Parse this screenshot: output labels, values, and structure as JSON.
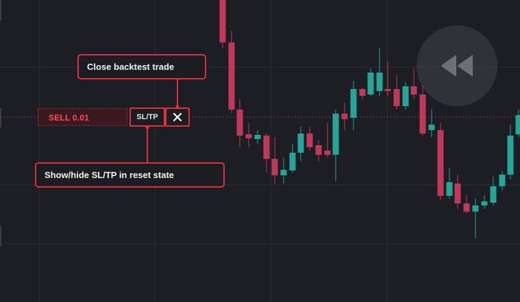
{
  "colors": {
    "background": "#1c1e23",
    "grid": "#2a2d33",
    "bullish": "#26a69a",
    "bearish": "#c0395a",
    "accent": "#e0303e"
  },
  "trade": {
    "label": "SELL 0.01",
    "sltp_label": "SL/TP",
    "close_symbol": "✕"
  },
  "tooltips": {
    "close": "Close backtest trade",
    "sltp": "Show/hide SL/TP in reset state"
  },
  "controls": {
    "rewind_icon": "rewind-icon"
  }
}
